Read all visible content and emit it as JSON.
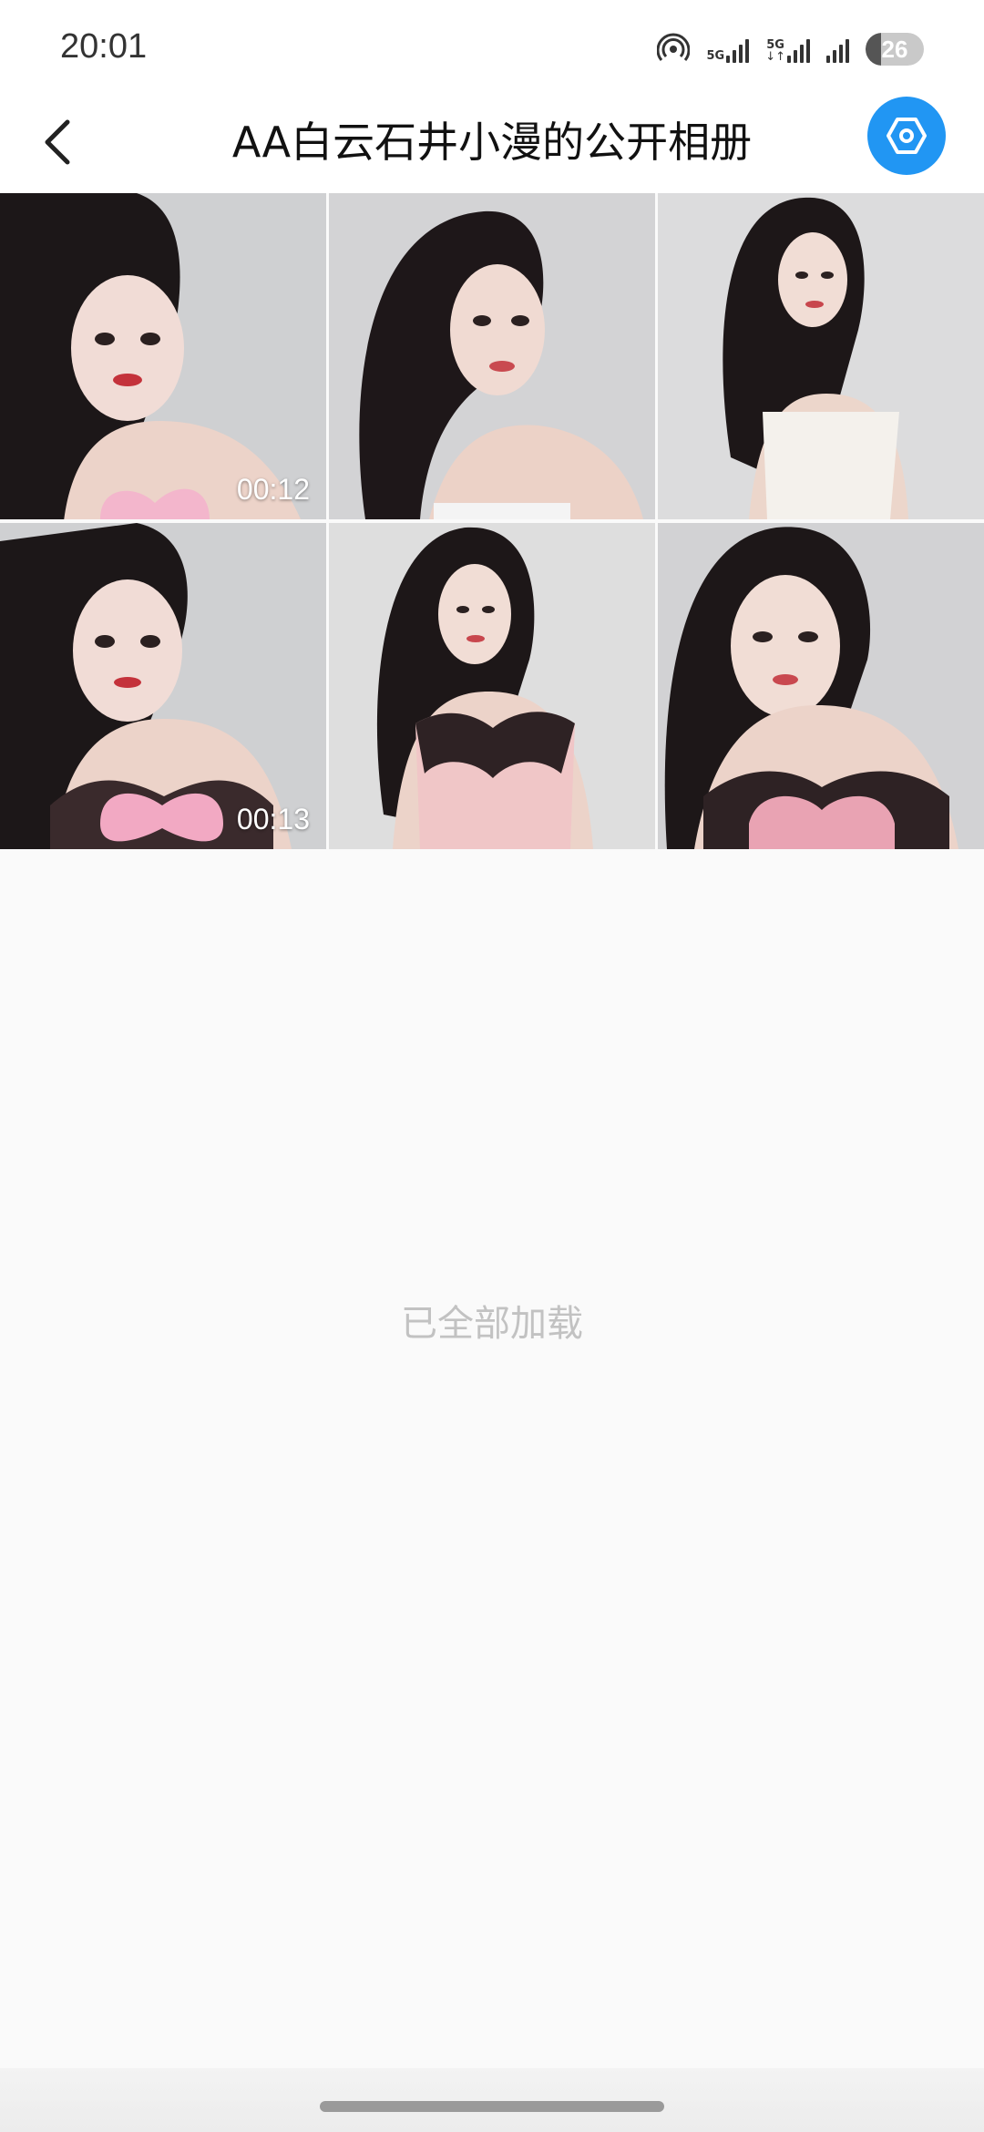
{
  "status_bar": {
    "time": "20:01",
    "network1_label": "5G",
    "network2_label": "5G",
    "network2_arrows": "↓↑",
    "battery_level": "26",
    "battery_fraction": 0.26,
    "icons": [
      "hotspot-icon",
      "signal-icon",
      "signal-icon",
      "signal-icon",
      "battery-icon"
    ]
  },
  "header": {
    "title": "AA白云石井小漫的公开相册",
    "back_icon": "chevron-left-icon",
    "settings_icon": "hexagon-settings-icon",
    "accent_color": "#2196f3"
  },
  "album": {
    "items": [
      {
        "type": "video",
        "duration": "00:12",
        "bg": "#cfd0d2"
      },
      {
        "type": "photo",
        "duration": "",
        "bg": "#d3d3d5"
      },
      {
        "type": "photo",
        "duration": "",
        "bg": "#dcdcdd"
      },
      {
        "type": "video",
        "duration": "00:13",
        "bg": "#cfd0d2"
      },
      {
        "type": "photo",
        "duration": "",
        "bg": "#dedede"
      },
      {
        "type": "photo",
        "duration": "",
        "bg": "#d2d2d4"
      }
    ]
  },
  "footer": {
    "loaded_text": "已全部加载"
  }
}
